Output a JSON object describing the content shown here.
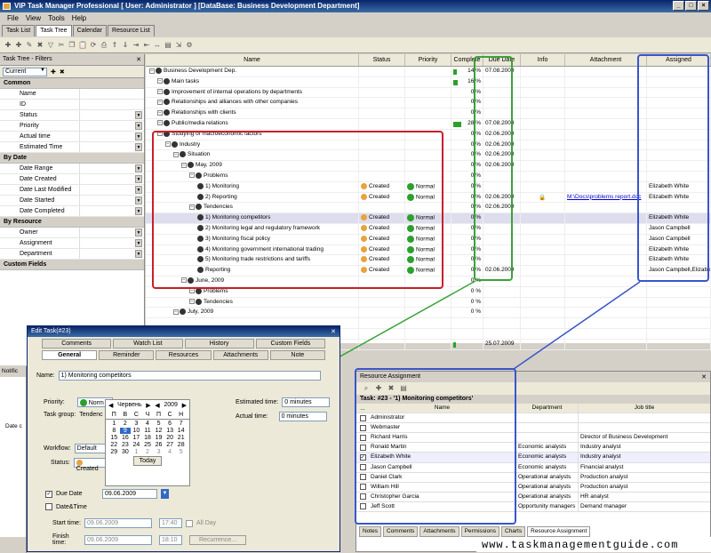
{
  "window": {
    "title": "VIP Task Manager Professional [ User: Administrator ] [DataBase: Business Development Department]"
  },
  "menu": [
    "File",
    "View",
    "Tools",
    "Help"
  ],
  "tabs": [
    "Task List",
    "Task Tree",
    "Calendar",
    "Resource List"
  ],
  "active_tab": "Task Tree",
  "filters": {
    "title": "Task Tree - Filters",
    "current": "Current",
    "sections": [
      {
        "name": "Common",
        "items": [
          "Name",
          "ID",
          "Status",
          "Priority",
          "Actual time",
          "Estimated Time"
        ]
      },
      {
        "name": "By Date",
        "items": [
          "Date Range",
          "Date Created",
          "Date Last Modified",
          "Date Started",
          "Date Completed"
        ]
      },
      {
        "name": "By Resource",
        "items": [
          "Owner",
          "Assignment",
          "Department"
        ]
      },
      {
        "name": "Custom Fields",
        "items": []
      }
    ]
  },
  "grid": {
    "columns": [
      "Name",
      "Status",
      "Priority",
      "Complete",
      "Due Date",
      "Info",
      "Attachment",
      "Assigned"
    ],
    "rows": [
      {
        "indent": 0,
        "name": "Business Development Dep.",
        "status": "",
        "priority": "",
        "complete": "14 %",
        "pct": 14,
        "due": "07.08.2009",
        "att": "",
        "ass": ""
      },
      {
        "indent": 1,
        "name": "Main tasks",
        "status": "",
        "priority": "",
        "complete": "16 %",
        "pct": 16,
        "due": "",
        "att": "",
        "ass": ""
      },
      {
        "indent": 1,
        "name": "Improvement of internal operations by departments",
        "status": "",
        "priority": "",
        "complete": "0 %",
        "pct": 0,
        "due": "",
        "att": "",
        "ass": ""
      },
      {
        "indent": 1,
        "name": "Relationships and alliances with other companies",
        "status": "",
        "priority": "",
        "complete": "0 %",
        "pct": 0,
        "due": "",
        "att": "",
        "ass": ""
      },
      {
        "indent": 1,
        "name": "Relationships with clients",
        "status": "",
        "priority": "",
        "complete": "0 %",
        "pct": 0,
        "due": "",
        "att": "",
        "ass": ""
      },
      {
        "indent": 1,
        "name": "Public/media relations",
        "status": "",
        "priority": "",
        "complete": "28 %",
        "pct": 28,
        "due": "07.08.2009",
        "att": "",
        "ass": ""
      },
      {
        "indent": 1,
        "name": "Studying of macroeconomic factors",
        "status": "",
        "priority": "",
        "complete": "0 %",
        "pct": 0,
        "due": "02.06.2009",
        "att": "",
        "ass": ""
      },
      {
        "indent": 2,
        "name": "Industry",
        "status": "",
        "priority": "",
        "complete": "0 %",
        "pct": 0,
        "due": "02.06.2009",
        "att": "",
        "ass": ""
      },
      {
        "indent": 3,
        "name": "Situation",
        "status": "",
        "priority": "",
        "complete": "0 %",
        "pct": 0,
        "due": "02.06.2009",
        "att": "",
        "ass": ""
      },
      {
        "indent": 4,
        "name": "May, 2009",
        "status": "",
        "priority": "",
        "complete": "0 %",
        "pct": 0,
        "due": "02.06.2009",
        "att": "",
        "ass": ""
      },
      {
        "indent": 5,
        "name": "Problems",
        "status": "",
        "priority": "",
        "complete": "0 %",
        "pct": 0,
        "due": "",
        "att": "",
        "ass": ""
      },
      {
        "indent": 6,
        "name": "1) Monitoring",
        "status": "Created",
        "priority": "Normal",
        "complete": "0 %",
        "pct": 0,
        "due": "",
        "att": "",
        "ass": "Elizabeth White"
      },
      {
        "indent": 6,
        "name": "2) Reporting",
        "status": "Created",
        "priority": "Normal",
        "complete": "0 %",
        "pct": 0,
        "due": "02.06.2009",
        "att": "M:\\Docs\\problems report.doc",
        "ass": "Elizabeth White"
      },
      {
        "indent": 5,
        "name": "Tendencies",
        "status": "",
        "priority": "",
        "complete": "0 %",
        "pct": 0,
        "due": "02.06.2009",
        "att": "",
        "ass": ""
      },
      {
        "indent": 6,
        "name": "1) Monitoring competitors",
        "status": "Created",
        "priority": "Normal",
        "complete": "0 %",
        "pct": 0,
        "due": "",
        "att": "",
        "ass": "Elizabeth White",
        "selected": true
      },
      {
        "indent": 6,
        "name": "2) Monitoring legal and regulatory framework",
        "status": "Created",
        "priority": "Normal",
        "complete": "0 %",
        "pct": 0,
        "due": "",
        "att": "",
        "ass": "Jason Campbell"
      },
      {
        "indent": 6,
        "name": "3) Monitoring fiscal policy",
        "status": "Created",
        "priority": "Normal",
        "complete": "0 %",
        "pct": 0,
        "due": "",
        "att": "",
        "ass": "Jason Campbell"
      },
      {
        "indent": 6,
        "name": "4) Monitoring government international trading",
        "status": "Created",
        "priority": "Normal",
        "complete": "0 %",
        "pct": 0,
        "due": "",
        "att": "",
        "ass": "Elizabeth White"
      },
      {
        "indent": 6,
        "name": "5) Monitoring trade restrictions and tariffs",
        "status": "Created",
        "priority": "Normal",
        "complete": "0 %",
        "pct": 0,
        "due": "",
        "att": "",
        "ass": "Elizabeth White"
      },
      {
        "indent": 6,
        "name": "Reporting",
        "status": "Created",
        "priority": "Normal",
        "complete": "0 %",
        "pct": 0,
        "due": "02.06.2009",
        "att": "",
        "ass": "Jason Campbell,Elizabeth White"
      },
      {
        "indent": 4,
        "name": "June, 2009",
        "status": "",
        "priority": "",
        "complete": "0 %",
        "pct": 0,
        "due": "",
        "att": "",
        "ass": ""
      },
      {
        "indent": 5,
        "name": "Problems",
        "status": "",
        "priority": "",
        "complete": "0 %",
        "pct": 0,
        "due": "",
        "att": "",
        "ass": ""
      },
      {
        "indent": 5,
        "name": "Tendencies",
        "status": "",
        "priority": "",
        "complete": "0 %",
        "pct": 0,
        "due": "",
        "att": "",
        "ass": ""
      },
      {
        "indent": 3,
        "name": "July, 2009",
        "status": "",
        "priority": "",
        "complete": "0 %",
        "pct": 0,
        "due": "",
        "att": "",
        "ass": ""
      },
      {
        "indent": 3,
        "name": "",
        "status": "",
        "priority": "",
        "complete": "",
        "pct": 0,
        "due": "",
        "att": "",
        "ass": ""
      },
      {
        "indent": 3,
        "name": "",
        "status": "",
        "priority": "",
        "complete": "",
        "pct": 0,
        "due": "",
        "att": "",
        "ass": ""
      },
      {
        "indent": 0,
        "name": "",
        "status": "",
        "priority": "",
        "complete": "",
        "pct": 9,
        "due": "25.07.2009",
        "att": "",
        "ass": ""
      }
    ]
  },
  "notif": {
    "title": "Notific",
    "date_label": "Date c"
  },
  "edit": {
    "title": "Edit Task(#23)",
    "tabs_top": [
      "Comments",
      "Watch List",
      "History",
      "Custom Fields"
    ],
    "tabs_bottom": [
      "General",
      "Reminder",
      "Resources",
      "Attachments",
      "Note"
    ],
    "name_label": "Name:",
    "name_value": "1) Monitoring competitors",
    "priority_label": "Priority:",
    "priority_value": "Norm",
    "taskgroup_label": "Task group:",
    "taskgroup_value": "Tendenc",
    "est_label": "Estimated time:",
    "est_value": "0 minutes",
    "act_label": "Actual time:",
    "act_value": "0 minutes",
    "workflow_label": "Workflow:",
    "workflow_value": "Default",
    "status_label": "Status:",
    "status_value": "Created",
    "duedate_label": "Due Date",
    "duedate_value": "09.06.2009",
    "datetime_label": "Date&Time",
    "start_label": "Start time:",
    "start_value": "09.06.2009",
    "start_time": "17:40",
    "allday_label": "All Day",
    "finish_label": "Finish time:",
    "finish_value": "09.06.2009",
    "finish_time": "18:10",
    "recurrence_label": "Recurrence..."
  },
  "calendar": {
    "month": "Червень",
    "year": "2009",
    "weekdays": [
      "П",
      "В",
      "С",
      "Ч",
      "П",
      "С",
      "Н"
    ],
    "days": [
      {
        "d": "1",
        "dim": false
      },
      {
        "d": "2",
        "dim": false
      },
      {
        "d": "3",
        "dim": false
      },
      {
        "d": "4",
        "dim": false
      },
      {
        "d": "5",
        "dim": false
      },
      {
        "d": "6",
        "dim": false
      },
      {
        "d": "7",
        "dim": false
      },
      {
        "d": "8",
        "dim": false
      },
      {
        "d": "9",
        "dim": false,
        "today": true
      },
      {
        "d": "10",
        "dim": false
      },
      {
        "d": "11",
        "dim": false
      },
      {
        "d": "12",
        "dim": false
      },
      {
        "d": "13",
        "dim": false
      },
      {
        "d": "14",
        "dim": false
      },
      {
        "d": "15",
        "dim": false
      },
      {
        "d": "16",
        "dim": false
      },
      {
        "d": "17",
        "dim": false
      },
      {
        "d": "18",
        "dim": false
      },
      {
        "d": "19",
        "dim": false
      },
      {
        "d": "20",
        "dim": false
      },
      {
        "d": "21",
        "dim": false
      },
      {
        "d": "22",
        "dim": false
      },
      {
        "d": "23",
        "dim": false
      },
      {
        "d": "24",
        "dim": false
      },
      {
        "d": "25",
        "dim": false
      },
      {
        "d": "26",
        "dim": false
      },
      {
        "d": "27",
        "dim": false
      },
      {
        "d": "28",
        "dim": false
      },
      {
        "d": "29",
        "dim": false
      },
      {
        "d": "30",
        "dim": false
      },
      {
        "d": "1",
        "dim": true
      },
      {
        "d": "2",
        "dim": true
      },
      {
        "d": "3",
        "dim": true
      },
      {
        "d": "4",
        "dim": true
      },
      {
        "d": "5",
        "dim": true
      }
    ],
    "today_label": "Today"
  },
  "resource": {
    "title": "Resource Assignment",
    "task": "Task: #23 - '1) Monitoring competitors'",
    "headers": [
      "...",
      "Name",
      "Department",
      "Job title"
    ],
    "rows": [
      {
        "checked": false,
        "name": "Administrator",
        "dept": "",
        "job": ""
      },
      {
        "checked": false,
        "name": "Webmaster",
        "dept": "",
        "job": ""
      },
      {
        "checked": false,
        "name": "Richard Harris",
        "dept": "",
        "job": "Director of Business Development"
      },
      {
        "checked": false,
        "name": "Ronald Martin",
        "dept": "Economic analysts",
        "job": "Industry analyst"
      },
      {
        "checked": true,
        "name": "Elizabeth White",
        "dept": "Economic analysts",
        "job": "Industry analyst"
      },
      {
        "checked": false,
        "name": "Jason Campbell",
        "dept": "Economic analysts",
        "job": "Financial analyst"
      },
      {
        "checked": false,
        "name": "Daniel Clark",
        "dept": "Operational analysts",
        "job": "Production analyst"
      },
      {
        "checked": false,
        "name": "William Hill",
        "dept": "Operational analysts",
        "job": "Production analyst"
      },
      {
        "checked": false,
        "name": "Christopher Garcia",
        "dept": "Operational analysts",
        "job": "HR analyst"
      },
      {
        "checked": false,
        "name": "Jeff Scott",
        "dept": "Opportunity managers",
        "job": "Demand manager"
      }
    ]
  },
  "bottom_tabs": [
    "Notes",
    "Comments",
    "Attachments",
    "Permissions",
    "Charts",
    "Resource Assignment"
  ],
  "watermark": "www.taskmanagementguide.com"
}
